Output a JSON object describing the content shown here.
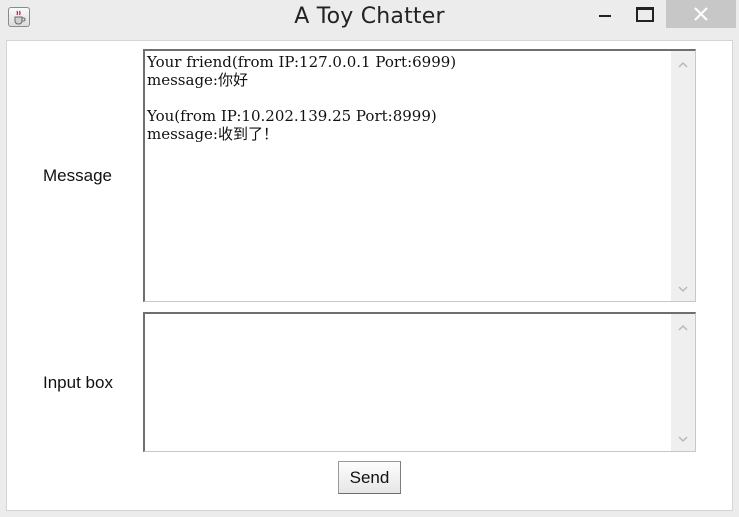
{
  "window": {
    "title": "A Toy Chatter",
    "icon": "java-cup-icon",
    "controls": [
      "minimize-icon",
      "maximize-icon",
      "close-icon"
    ]
  },
  "form": {
    "message_label": "Message",
    "input_label": "Input box",
    "message_text": "Your friend(from IP:127.0.0.1 Port:6999)\nmessage:你好\n\nYou(from IP:10.202.139.25 Port:8999)\nmessage:收到了！",
    "input_text": "",
    "send_label": "Send"
  }
}
